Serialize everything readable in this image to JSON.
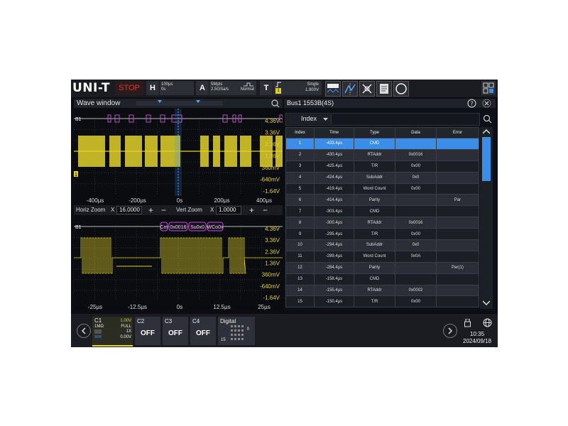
{
  "topbar": {
    "logo": "UNI-T",
    "run_state": "STOP",
    "horiz": {
      "key": "H",
      "timebase": "100µs",
      "offset": "0s"
    },
    "acq": {
      "key": "A",
      "points": "5Mpts",
      "rate": "2.5GSa/s",
      "mode": "Normal"
    },
    "trig": {
      "key": "T",
      "source": "1",
      "mode": "Single",
      "level": "1.800V"
    }
  },
  "wave_window": {
    "title": "Wave window",
    "upper": {
      "channel_tag": "B1",
      "trigger_tag": "1",
      "y_ticks": [
        "4.36V",
        "3.36V",
        "2.36V",
        "1.36V",
        "360mV",
        "-640mV",
        "-1.64V"
      ],
      "x_ticks": [
        "-400µs",
        "-200µs",
        "0s",
        "200µs",
        "400µs"
      ]
    },
    "zoom": {
      "horiz_label": "Horiz Zoom",
      "horiz_x": "X",
      "horiz_value": "16.0000",
      "vert_label": "Vert Zoom",
      "vert_x": "X",
      "vert_value": "1.0000",
      "plus": "+",
      "minus": "−"
    },
    "lower": {
      "channel_tag": "B1",
      "decode_labels": [
        "Cm",
        "0x0016",
        "Su0x0",
        "WCo0x"
      ],
      "y_ticks": [
        "4.36V",
        "3.36V",
        "2.36V",
        "1.36V",
        "360mV",
        "-640mV",
        "-1.64V"
      ],
      "x_ticks": [
        "-25µs",
        "-12.5µs",
        "0s",
        "12.5µs",
        "25µs"
      ]
    }
  },
  "bus": {
    "title": "Bus1 1553B(4S)",
    "index_label": "Index",
    "columns": [
      "Index",
      "Time",
      "Type",
      "Data",
      "Error"
    ],
    "rows": [
      {
        "index": "1",
        "time": "-433.4µs",
        "type": "CMD",
        "data": "",
        "error": ""
      },
      {
        "index": "2",
        "time": "-430.4µs",
        "type": "RTAddr",
        "data": "0x0016",
        "error": ""
      },
      {
        "index": "3",
        "time": "-425.4µs",
        "type": "T/R",
        "data": "0x00",
        "error": ""
      },
      {
        "index": "4",
        "time": "-424.4µs",
        "type": "SubAddr",
        "data": "0x0",
        "error": ""
      },
      {
        "index": "5",
        "time": "-419.4µs",
        "type": "Word Count",
        "data": "0x00",
        "error": ""
      },
      {
        "index": "6",
        "time": "-414.4µs",
        "type": "Parity",
        "data": "",
        "error": "Par"
      },
      {
        "index": "7",
        "time": "-303.4µs",
        "type": "CMD",
        "data": "",
        "error": ""
      },
      {
        "index": "8",
        "time": "-300.4µs",
        "type": "RTAddr",
        "data": "0x0016",
        "error": ""
      },
      {
        "index": "9",
        "time": "-295.4µs",
        "type": "T/R",
        "data": "0x00",
        "error": ""
      },
      {
        "index": "10",
        "time": "-294.4µs",
        "type": "SubAddr",
        "data": "0x0",
        "error": ""
      },
      {
        "index": "11",
        "time": "-289.4µs",
        "type": "Word Count",
        "data": "0x0A",
        "error": ""
      },
      {
        "index": "12",
        "time": "-284.4µs",
        "type": "Parity",
        "data": "",
        "error": "Par(1)"
      },
      {
        "index": "13",
        "time": "-158.4µs",
        "type": "CMD",
        "data": "",
        "error": ""
      },
      {
        "index": "14",
        "time": "-155.4µs",
        "type": "RTAddr",
        "data": "0x0002",
        "error": ""
      },
      {
        "index": "15",
        "time": "-150.4µs",
        "type": "T/R",
        "data": "0x00",
        "error": ""
      }
    ],
    "selected_index": "1",
    "scroll_position": 0.25
  },
  "bottombar": {
    "c1": {
      "name": "C1",
      "scale": "1.00V",
      "imp": "1MΩ",
      "bw": "FULL",
      "probe": "1X",
      "offset": "0.00V"
    },
    "c2": {
      "name": "C2",
      "state": "OFF"
    },
    "c3": {
      "name": "C3",
      "state": "OFF"
    },
    "c4": {
      "name": "C4",
      "state": "OFF"
    },
    "digital": {
      "name": "Digital",
      "lo": "0",
      "hi": "15"
    },
    "time": "10:35",
    "date": "2024/09/18"
  },
  "colors": {
    "ch1": "#e2d12a",
    "decode": "#b94fc9",
    "select": "#3b8ee8",
    "stop": "#e3342f"
  }
}
